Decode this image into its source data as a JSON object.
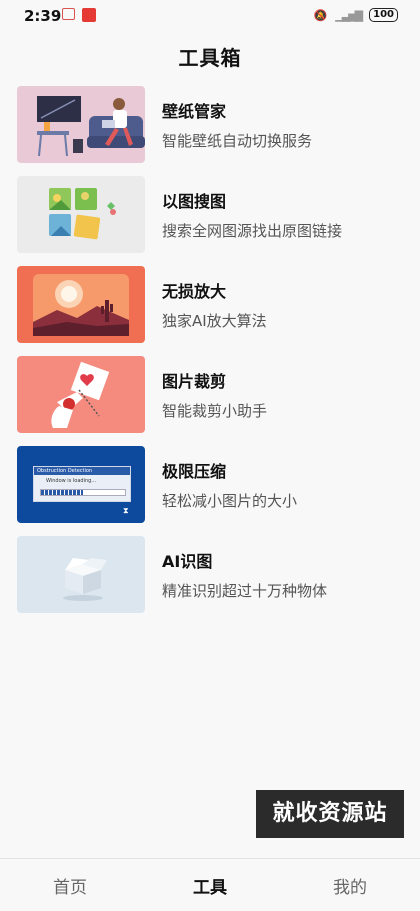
{
  "status": {
    "time": "2:39",
    "battery": "100"
  },
  "page": {
    "title": "工具箱"
  },
  "tools": [
    {
      "name": "壁纸管家",
      "desc": "智能壁纸自动切换服务"
    },
    {
      "name": "以图搜图",
      "desc": "搜索全网图源找出原图链接"
    },
    {
      "name": "无损放大",
      "desc": "独家AI放大算法"
    },
    {
      "name": "图片裁剪",
      "desc": "智能裁剪小助手"
    },
    {
      "name": "极限压缩",
      "desc": "轻松减小图片的大小"
    },
    {
      "name": "AI识图",
      "desc": "精准识别超过十万种物体"
    }
  ],
  "thumb_text": {
    "dialog_title": "Obstruction Detection",
    "loading": "Window is loading..."
  },
  "watermark": "就收资源站",
  "tabs": {
    "home": "首页",
    "tools": "工具",
    "mine": "我的"
  },
  "colors": {
    "wallpaper_bg": "#e9c9d6",
    "upscale_bg": "#f06f52",
    "crop_bg": "#f58b7e",
    "compress_bg": "#0d4a9e",
    "ai_bg": "#dbe6ef"
  }
}
